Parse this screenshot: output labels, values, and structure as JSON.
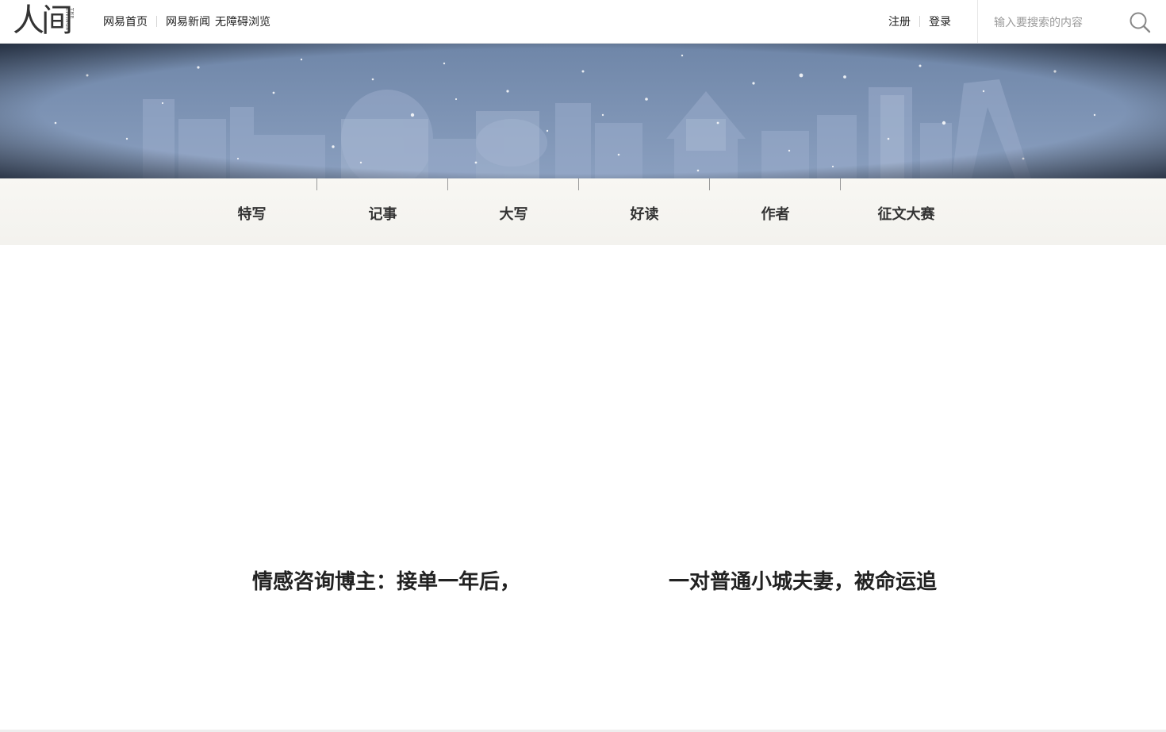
{
  "brand": {
    "logo_text": "人间",
    "logo_subtext": "THE LIVINGS"
  },
  "topnav": {
    "home": "网易首页",
    "news": "网易新闻",
    "accessibility": "无障碍浏览"
  },
  "auth": {
    "register": "注册",
    "login": "登录"
  },
  "search": {
    "placeholder": "输入要搜索的内容",
    "icon": "search-icon"
  },
  "banner": {
    "description_icon": "snowy-city-skyline-banner"
  },
  "channels": [
    {
      "label": "特写"
    },
    {
      "label": "记事"
    },
    {
      "label": "大写"
    },
    {
      "label": "好读"
    },
    {
      "label": "作者"
    },
    {
      "label": "征文大赛"
    }
  ],
  "headlines": [
    {
      "title": "情感咨询博主：接单一年后，"
    },
    {
      "title": "一对普通小城夫妻，被命运追"
    }
  ],
  "colors": {
    "banner_sky": "#7d93b4",
    "channel_bar": "#f5f4f0",
    "text": "#222222"
  }
}
